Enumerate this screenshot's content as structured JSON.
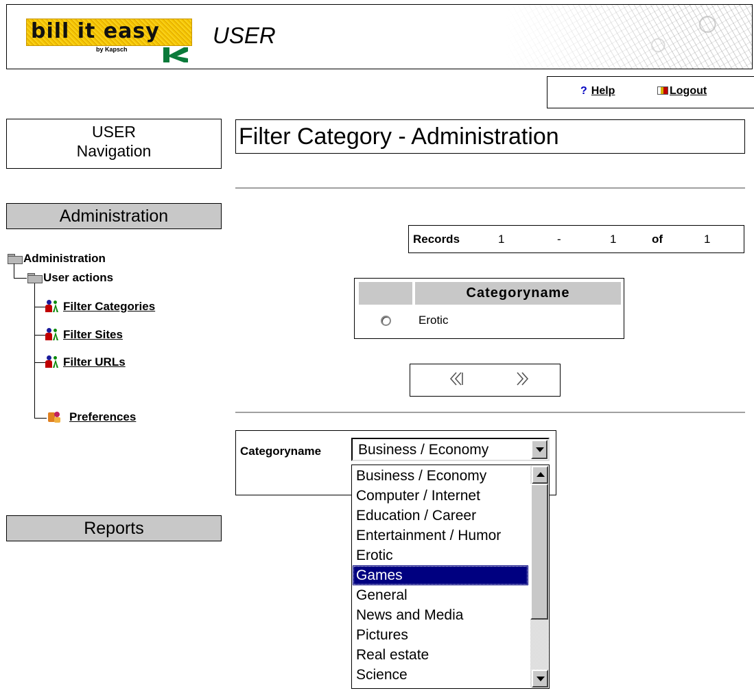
{
  "header": {
    "logo_text": "bill it easy",
    "logo_byline": "by Kapsch",
    "app_title": "USER"
  },
  "toolbar": {
    "help_icon": "?",
    "help_label": "Help",
    "logout_label": "Logout"
  },
  "nav": {
    "title_line1": "USER",
    "title_line2": "Navigation",
    "admin_section": "Administration",
    "reports_section": "Reports",
    "tree": {
      "root": "Administration",
      "child": "User actions",
      "links": [
        "Filter Categories",
        "Filter Sites",
        "Filter URLs"
      ],
      "preferences": "Preferences"
    }
  },
  "main": {
    "page_title": "Filter Category - Administration",
    "records": {
      "label": "Records",
      "from": "1",
      "dash": "-",
      "to": "1",
      "of_label": "of",
      "total": "1"
    },
    "table": {
      "column_header": "Categoryname",
      "rows": [
        {
          "name": "Erotic"
        }
      ]
    },
    "pager": {
      "prev": "«",
      "next": "»"
    },
    "form": {
      "label": "Categoryname",
      "selected": "Business / Economy",
      "options": [
        "Business / Economy",
        "Computer / Internet",
        "Education / Career",
        "Entertainment / Humor",
        "Erotic",
        "Games",
        "General",
        "News and Media",
        "Pictures",
        "Real estate",
        "Science"
      ],
      "highlighted_option": "Games"
    }
  },
  "colors": {
    "section_header_bg": "#c8c8c8",
    "dropdown_highlight": "#000080",
    "logo_yellow": "#f4c400"
  }
}
